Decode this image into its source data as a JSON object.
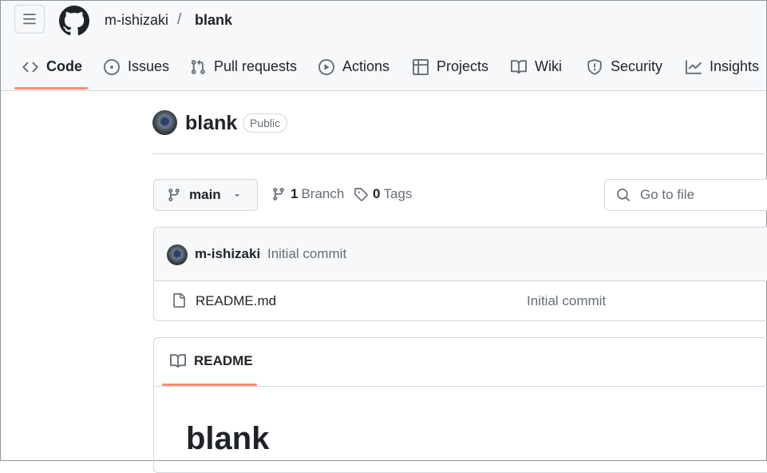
{
  "breadcrumb": {
    "owner": "m-ishizaki",
    "separator": "/",
    "repo": "blank"
  },
  "nav_tabs": [
    {
      "label": "Code",
      "icon": "code-icon"
    },
    {
      "label": "Issues",
      "icon": "issue-opened-icon"
    },
    {
      "label": "Pull requests",
      "icon": "git-pull-request-icon"
    },
    {
      "label": "Actions",
      "icon": "play-icon"
    },
    {
      "label": "Projects",
      "icon": "table-icon"
    },
    {
      "label": "Wiki",
      "icon": "book-icon"
    },
    {
      "label": "Security",
      "icon": "shield-icon"
    },
    {
      "label": "Insights",
      "icon": "graph-icon"
    }
  ],
  "repo": {
    "name": "blank",
    "visibility": "Public"
  },
  "toolbar": {
    "branch": "main",
    "branch_count": "1",
    "branch_label": "Branch",
    "tag_count": "0",
    "tag_label": "Tags",
    "go_to_file_placeholder": "Go to file"
  },
  "latest_commit": {
    "author": "m-ishizaki",
    "message": "Initial commit"
  },
  "files": [
    {
      "name": "README.md",
      "commit_message": "Initial commit"
    }
  ],
  "readme": {
    "tab_label": "README",
    "heading": "blank"
  },
  "colors": {
    "accent_underline": "#fd8c73",
    "border": "#d0d7de",
    "muted_text": "#656d76"
  }
}
